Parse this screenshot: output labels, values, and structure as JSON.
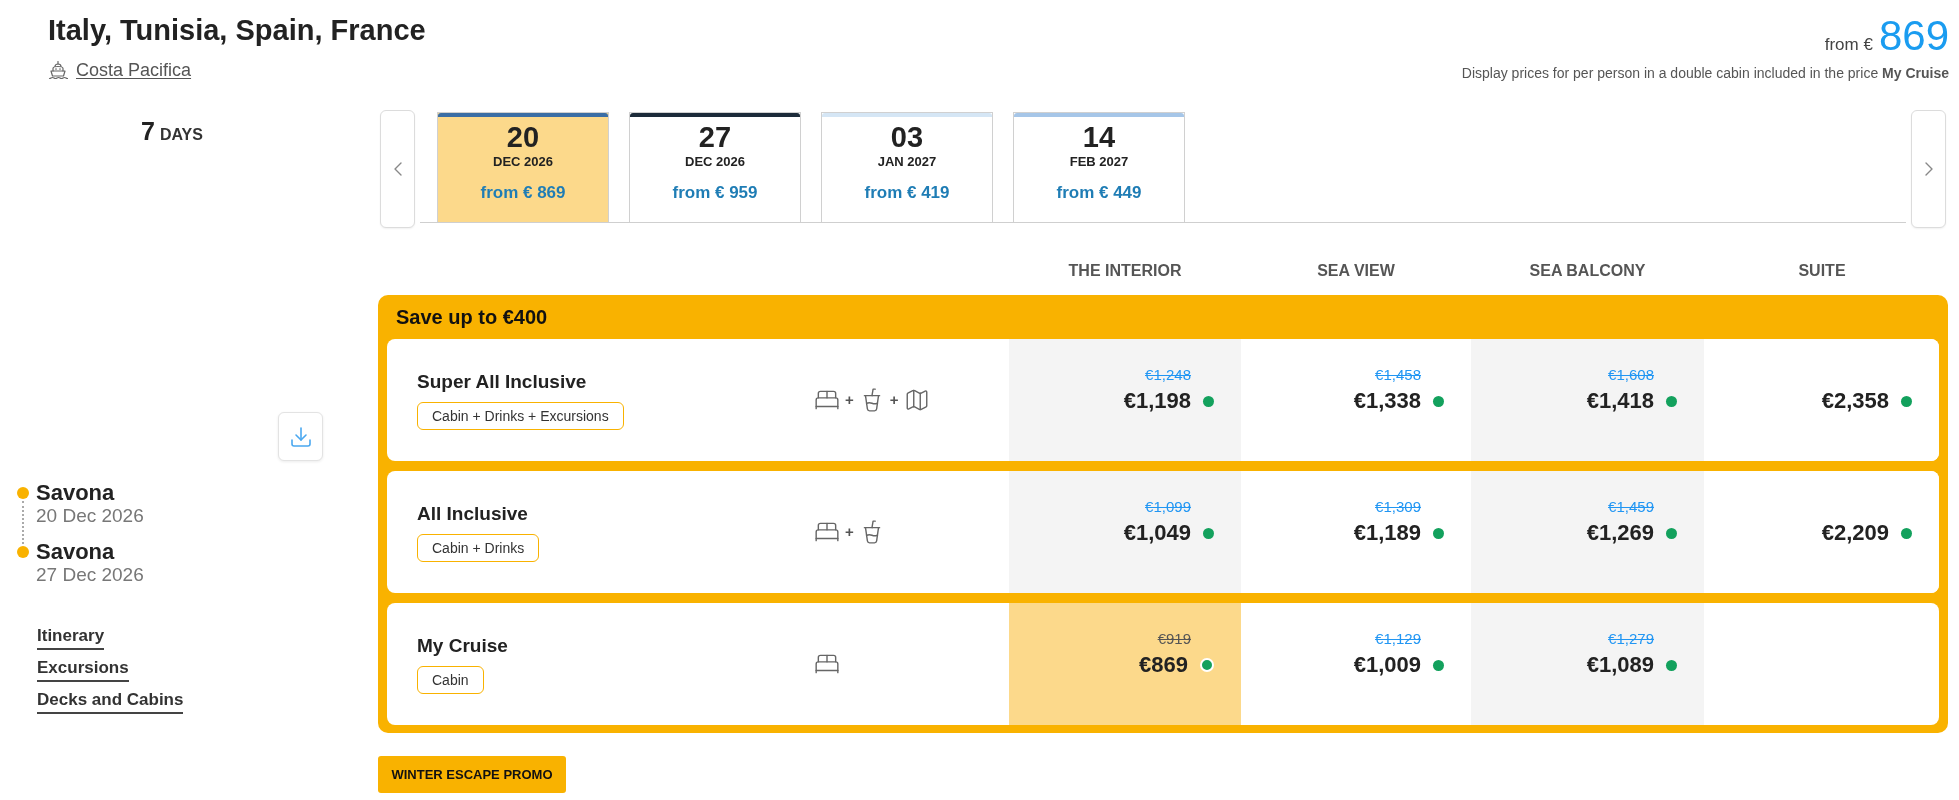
{
  "header": {
    "title": "Italy, Tunisia, Spain, France",
    "ship": "Costa Pacifica",
    "price_label": "from €",
    "price": "869",
    "note": "Display prices for per person in a double cabin included in the price **My Cruise**"
  },
  "duration": {
    "number": "7",
    "unit": "DAYS"
  },
  "date_tabs": [
    {
      "day": "20",
      "month": "DEC 2026",
      "price": "from € 869",
      "selected": true,
      "color": "#3b6ea5"
    },
    {
      "day": "27",
      "month": "DEC 2026",
      "price": "from € 959",
      "selected": false,
      "color": "#1c2b3a"
    },
    {
      "day": "03",
      "month": "JAN 2027",
      "price": "from € 419",
      "selected": false,
      "color": "#d5e6f5"
    },
    {
      "day": "14",
      "month": "FEB 2027",
      "price": "from € 449",
      "selected": false,
      "color": "#a6c6e8"
    }
  ],
  "columns": [
    "THE INTERIOR",
    "SEA VIEW",
    "SEA BALCONY",
    "SUITE"
  ],
  "offer": {
    "title": "Save up to €400",
    "packages": [
      {
        "name": "Super All Inclusive",
        "tag": "Cabin + Drinks + Excursions",
        "amenities": [
          {
            "kind": "bed"
          },
          {
            "kind": "drinks",
            "joiner": "+"
          },
          {
            "kind": "map",
            "joiner": "+"
          }
        ],
        "prices": [
          {
            "old": "€1,248",
            "price": "€1,198",
            "selected": false,
            "available": true
          },
          {
            "old": "€1,458",
            "price": "€1,338",
            "selected": false,
            "available": true
          },
          {
            "old": "€1,608",
            "price": "€1,418",
            "selected": false,
            "available": true
          },
          {
            "price": "€2,358",
            "selected": false,
            "available": true
          }
        ]
      },
      {
        "name": "All Inclusive",
        "tag": "Cabin + Drinks",
        "amenities": [
          {
            "kind": "bed"
          },
          {
            "kind": "drinks",
            "joiner": "+"
          }
        ],
        "prices": [
          {
            "old": "€1,099",
            "price": "€1,049",
            "selected": false,
            "available": true
          },
          {
            "old": "€1,309",
            "price": "€1,189",
            "selected": false,
            "available": true
          },
          {
            "old": "€1,459",
            "price": "€1,269",
            "selected": false,
            "available": true
          },
          {
            "price": "€2,209",
            "selected": false,
            "available": true
          }
        ]
      },
      {
        "name": "My Cruise",
        "tag": "Cabin",
        "amenities": [
          {
            "kind": "bed"
          }
        ],
        "prices": [
          {
            "old": "€919",
            "price": "€869",
            "selected": true,
            "available": true
          },
          {
            "old": "€1,129",
            "price": "€1,009",
            "selected": false,
            "available": true
          },
          {
            "old": "€1,279",
            "price": "€1,089",
            "selected": false,
            "available": true
          }
        ]
      }
    ]
  },
  "ports": [
    {
      "name": "Savona",
      "date": "20 Dec 2026"
    },
    {
      "name": "Savona",
      "date": "27 Dec 2026"
    }
  ],
  "links": [
    "Itinerary",
    "Excursions",
    "Decks and Cabins"
  ],
  "promo_button": "WINTER ESCAPE PROMO"
}
